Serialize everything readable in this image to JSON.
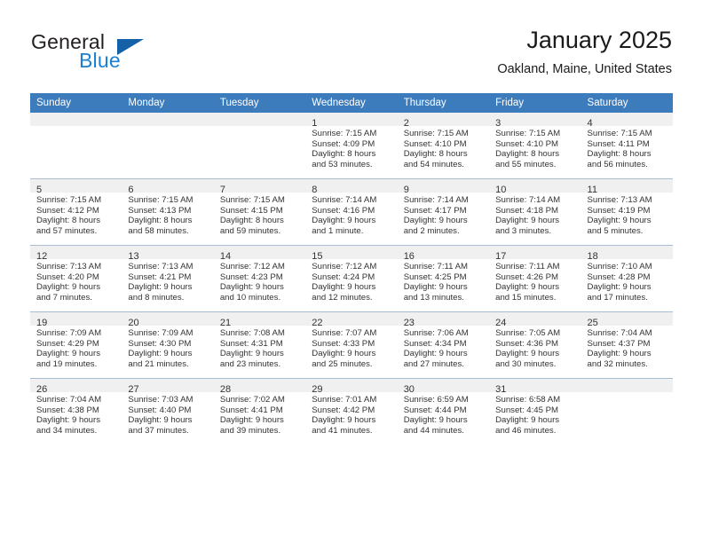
{
  "brand": {
    "name_part1": "General",
    "name_part2": "Blue"
  },
  "header": {
    "title": "January 2025",
    "subtitle": "Oakland, Maine, United States"
  },
  "weekday_headers": [
    "Sunday",
    "Monday",
    "Tuesday",
    "Wednesday",
    "Thursday",
    "Friday",
    "Saturday"
  ],
  "colors": {
    "header_blue": "#3c7cbd",
    "brand_blue": "#1b7fd4",
    "triangle_blue": "#1461a8",
    "daynum_band": "#f0f0f0",
    "row_divider": "#a9bed4"
  },
  "weeks": [
    [
      {
        "day": "",
        "empty": true
      },
      {
        "day": "",
        "empty": true
      },
      {
        "day": "",
        "empty": true
      },
      {
        "day": "1",
        "sunrise": "Sunrise: 7:15 AM",
        "sunset": "Sunset: 4:09 PM",
        "daylight1": "Daylight: 8 hours",
        "daylight2": "and 53 minutes."
      },
      {
        "day": "2",
        "sunrise": "Sunrise: 7:15 AM",
        "sunset": "Sunset: 4:10 PM",
        "daylight1": "Daylight: 8 hours",
        "daylight2": "and 54 minutes."
      },
      {
        "day": "3",
        "sunrise": "Sunrise: 7:15 AM",
        "sunset": "Sunset: 4:10 PM",
        "daylight1": "Daylight: 8 hours",
        "daylight2": "and 55 minutes."
      },
      {
        "day": "4",
        "sunrise": "Sunrise: 7:15 AM",
        "sunset": "Sunset: 4:11 PM",
        "daylight1": "Daylight: 8 hours",
        "daylight2": "and 56 minutes."
      }
    ],
    [
      {
        "day": "5",
        "sunrise": "Sunrise: 7:15 AM",
        "sunset": "Sunset: 4:12 PM",
        "daylight1": "Daylight: 8 hours",
        "daylight2": "and 57 minutes."
      },
      {
        "day": "6",
        "sunrise": "Sunrise: 7:15 AM",
        "sunset": "Sunset: 4:13 PM",
        "daylight1": "Daylight: 8 hours",
        "daylight2": "and 58 minutes."
      },
      {
        "day": "7",
        "sunrise": "Sunrise: 7:15 AM",
        "sunset": "Sunset: 4:15 PM",
        "daylight1": "Daylight: 8 hours",
        "daylight2": "and 59 minutes."
      },
      {
        "day": "8",
        "sunrise": "Sunrise: 7:14 AM",
        "sunset": "Sunset: 4:16 PM",
        "daylight1": "Daylight: 9 hours",
        "daylight2": "and 1 minute."
      },
      {
        "day": "9",
        "sunrise": "Sunrise: 7:14 AM",
        "sunset": "Sunset: 4:17 PM",
        "daylight1": "Daylight: 9 hours",
        "daylight2": "and 2 minutes."
      },
      {
        "day": "10",
        "sunrise": "Sunrise: 7:14 AM",
        "sunset": "Sunset: 4:18 PM",
        "daylight1": "Daylight: 9 hours",
        "daylight2": "and 3 minutes."
      },
      {
        "day": "11",
        "sunrise": "Sunrise: 7:13 AM",
        "sunset": "Sunset: 4:19 PM",
        "daylight1": "Daylight: 9 hours",
        "daylight2": "and 5 minutes."
      }
    ],
    [
      {
        "day": "12",
        "sunrise": "Sunrise: 7:13 AM",
        "sunset": "Sunset: 4:20 PM",
        "daylight1": "Daylight: 9 hours",
        "daylight2": "and 7 minutes."
      },
      {
        "day": "13",
        "sunrise": "Sunrise: 7:13 AM",
        "sunset": "Sunset: 4:21 PM",
        "daylight1": "Daylight: 9 hours",
        "daylight2": "and 8 minutes."
      },
      {
        "day": "14",
        "sunrise": "Sunrise: 7:12 AM",
        "sunset": "Sunset: 4:23 PM",
        "daylight1": "Daylight: 9 hours",
        "daylight2": "and 10 minutes."
      },
      {
        "day": "15",
        "sunrise": "Sunrise: 7:12 AM",
        "sunset": "Sunset: 4:24 PM",
        "daylight1": "Daylight: 9 hours",
        "daylight2": "and 12 minutes."
      },
      {
        "day": "16",
        "sunrise": "Sunrise: 7:11 AM",
        "sunset": "Sunset: 4:25 PM",
        "daylight1": "Daylight: 9 hours",
        "daylight2": "and 13 minutes."
      },
      {
        "day": "17",
        "sunrise": "Sunrise: 7:11 AM",
        "sunset": "Sunset: 4:26 PM",
        "daylight1": "Daylight: 9 hours",
        "daylight2": "and 15 minutes."
      },
      {
        "day": "18",
        "sunrise": "Sunrise: 7:10 AM",
        "sunset": "Sunset: 4:28 PM",
        "daylight1": "Daylight: 9 hours",
        "daylight2": "and 17 minutes."
      }
    ],
    [
      {
        "day": "19",
        "sunrise": "Sunrise: 7:09 AM",
        "sunset": "Sunset: 4:29 PM",
        "daylight1": "Daylight: 9 hours",
        "daylight2": "and 19 minutes."
      },
      {
        "day": "20",
        "sunrise": "Sunrise: 7:09 AM",
        "sunset": "Sunset: 4:30 PM",
        "daylight1": "Daylight: 9 hours",
        "daylight2": "and 21 minutes."
      },
      {
        "day": "21",
        "sunrise": "Sunrise: 7:08 AM",
        "sunset": "Sunset: 4:31 PM",
        "daylight1": "Daylight: 9 hours",
        "daylight2": "and 23 minutes."
      },
      {
        "day": "22",
        "sunrise": "Sunrise: 7:07 AM",
        "sunset": "Sunset: 4:33 PM",
        "daylight1": "Daylight: 9 hours",
        "daylight2": "and 25 minutes."
      },
      {
        "day": "23",
        "sunrise": "Sunrise: 7:06 AM",
        "sunset": "Sunset: 4:34 PM",
        "daylight1": "Daylight: 9 hours",
        "daylight2": "and 27 minutes."
      },
      {
        "day": "24",
        "sunrise": "Sunrise: 7:05 AM",
        "sunset": "Sunset: 4:36 PM",
        "daylight1": "Daylight: 9 hours",
        "daylight2": "and 30 minutes."
      },
      {
        "day": "25",
        "sunrise": "Sunrise: 7:04 AM",
        "sunset": "Sunset: 4:37 PM",
        "daylight1": "Daylight: 9 hours",
        "daylight2": "and 32 minutes."
      }
    ],
    [
      {
        "day": "26",
        "sunrise": "Sunrise: 7:04 AM",
        "sunset": "Sunset: 4:38 PM",
        "daylight1": "Daylight: 9 hours",
        "daylight2": "and 34 minutes."
      },
      {
        "day": "27",
        "sunrise": "Sunrise: 7:03 AM",
        "sunset": "Sunset: 4:40 PM",
        "daylight1": "Daylight: 9 hours",
        "daylight2": "and 37 minutes."
      },
      {
        "day": "28",
        "sunrise": "Sunrise: 7:02 AM",
        "sunset": "Sunset: 4:41 PM",
        "daylight1": "Daylight: 9 hours",
        "daylight2": "and 39 minutes."
      },
      {
        "day": "29",
        "sunrise": "Sunrise: 7:01 AM",
        "sunset": "Sunset: 4:42 PM",
        "daylight1": "Daylight: 9 hours",
        "daylight2": "and 41 minutes."
      },
      {
        "day": "30",
        "sunrise": "Sunrise: 6:59 AM",
        "sunset": "Sunset: 4:44 PM",
        "daylight1": "Daylight: 9 hours",
        "daylight2": "and 44 minutes."
      },
      {
        "day": "31",
        "sunrise": "Sunrise: 6:58 AM",
        "sunset": "Sunset: 4:45 PM",
        "daylight1": "Daylight: 9 hours",
        "daylight2": "and 46 minutes."
      },
      {
        "day": "",
        "empty": true
      }
    ]
  ]
}
